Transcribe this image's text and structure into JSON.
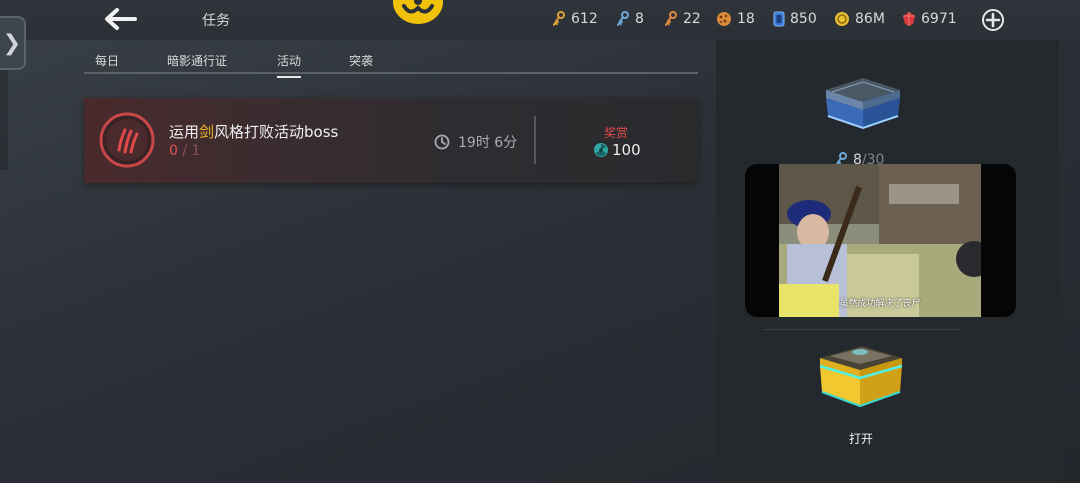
{
  "header": {
    "title": "任务",
    "resources": [
      {
        "icon": "gold-key-icon",
        "value": "612",
        "color": "#e0a23a"
      },
      {
        "icon": "blue-key-icon",
        "value": "8",
        "color": "#6fa8d8"
      },
      {
        "icon": "orange-key-icon",
        "value": "22",
        "color": "#e08a3a"
      },
      {
        "icon": "cookie-token-icon",
        "value": "18",
        "color": "#d98a3a"
      },
      {
        "icon": "blue-card-icon",
        "value": "850",
        "color": "#3a78d8"
      },
      {
        "icon": "gold-coin-icon",
        "value": "86M",
        "color": "#e8c030"
      },
      {
        "icon": "red-gem-icon",
        "value": "6971",
        "color": "#d83a3a"
      }
    ]
  },
  "tabs": [
    {
      "label": "每日",
      "active": false
    },
    {
      "label": "暗影通行证",
      "active": false
    },
    {
      "label": "活动",
      "active": true
    },
    {
      "label": "突袭",
      "active": false
    }
  ],
  "quest": {
    "name_prefix": "运用",
    "name_highlight": "剑",
    "name_suffix": "风格打败活动boss",
    "progress_current": "0",
    "progress_sep": " / ",
    "progress_total": "1",
    "timer": "19时 6分",
    "reward_label": "奖赏",
    "reward_value": "100"
  },
  "side_panel": {
    "keys_current": "8",
    "keys_sep": " / ",
    "keys_max": "30",
    "video_subtitle": "虽然成功解决了丧尸",
    "open_label": "打开"
  }
}
